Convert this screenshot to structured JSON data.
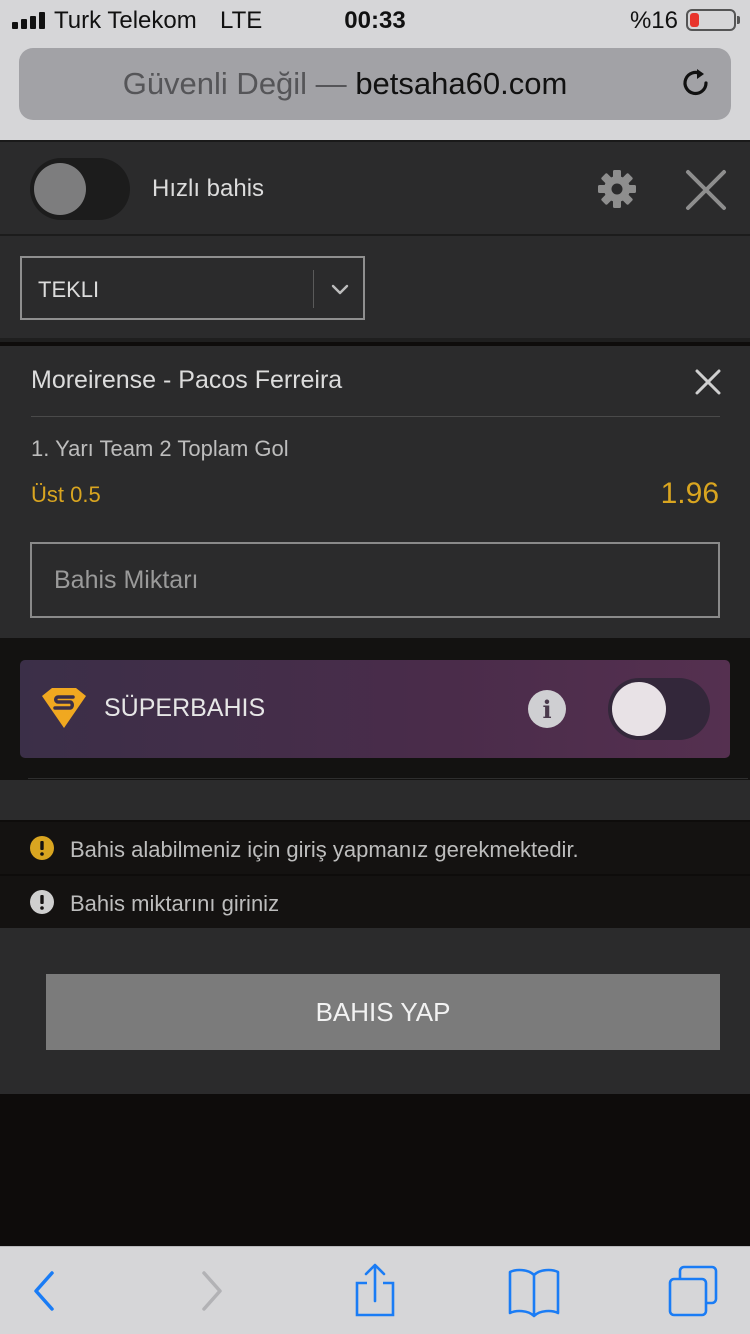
{
  "status_bar": {
    "carrier": "Turk Telekom",
    "network": "LTE",
    "time": "00:33",
    "battery_percent": "%16",
    "battery_level": 0.16
  },
  "browser": {
    "security_label": "Güvenli Değil —",
    "domain": "betsaha60.com"
  },
  "betslip": {
    "quick_bet_label": "Hızlı bahis",
    "bet_type": "TEKLI",
    "selection_card": {
      "match": "Moreirense - Pacos Ferreira",
      "market": "1. Yarı Team 2 Toplam Gol",
      "selection": "Üst 0.5",
      "odds": "1.96"
    },
    "stake_placeholder": "Bahis Miktarı",
    "superbahis_label": "SÜPERBAHIS",
    "messages": [
      {
        "text": "Bahis alabilmeniz için giriş yapmanız gerekmektedir.",
        "icon": "warning-icon",
        "color": "#d9a520"
      },
      {
        "text": "Bahis miktarını giriniz",
        "icon": "error-icon",
        "color": "#cfcfcf"
      }
    ],
    "place_bet_label": "BAHIS YAP"
  },
  "colors": {
    "accent": "#d9a520",
    "panel": "#2b2b2c",
    "safari_chrome": "#d6d6d8",
    "ios_blue": "#1a7cf5"
  }
}
